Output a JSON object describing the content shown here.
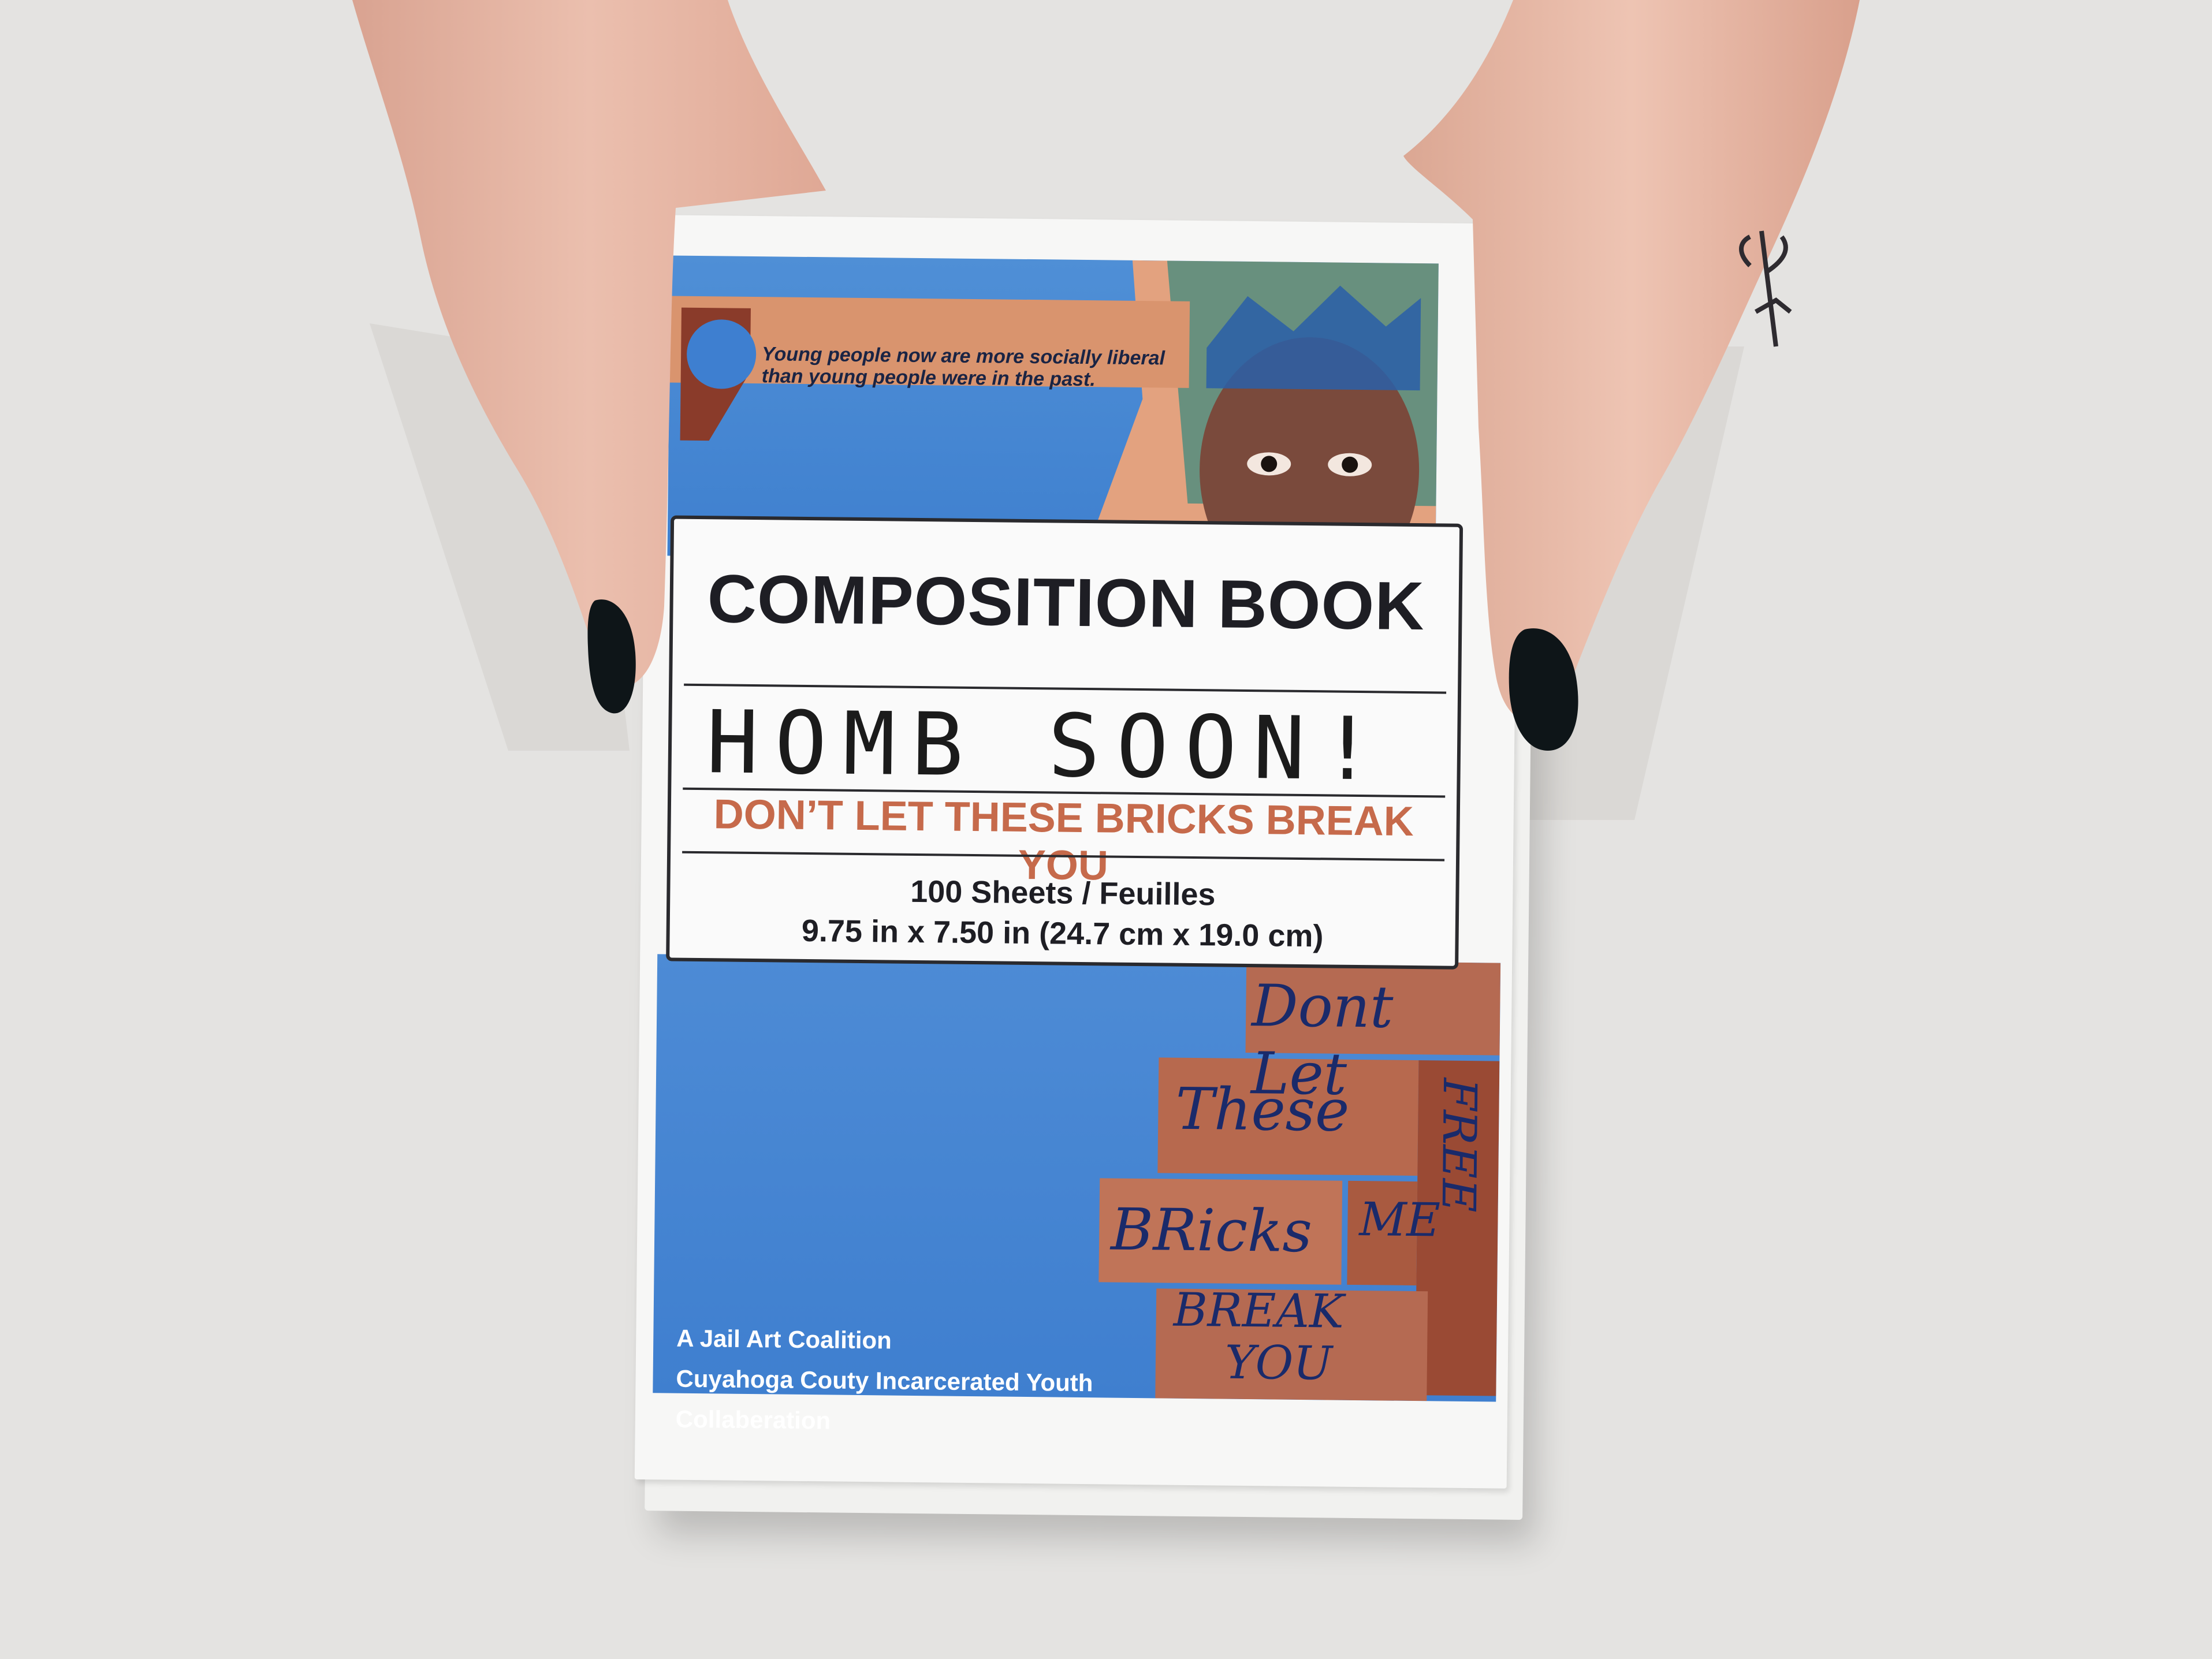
{
  "cover": {
    "title": "COMPOSITION BOOK",
    "handwritten_name": "HOMB SOON!",
    "tagline": "DON’T LET THESE BRICKS BREAK YOU",
    "sheets": "100 Sheets / Feuilles",
    "dimensions": "9.75 in x 7.50 in (24.7 cm x 19.0 cm)",
    "quote_line1": "Young people now are more socially liberal",
    "quote_line2": "than young people were in the past.",
    "credits": [
      "A Jail Art Coalition",
      "Cuyahoga Couty Incarcerated Youth",
      "Collaberation"
    ],
    "brick_words": [
      "Dont Let",
      "These",
      "BRicks",
      "BREAK",
      "YOU",
      "FREE",
      "ME"
    ]
  },
  "colors": {
    "background": "#e4e3e1",
    "cover_blue": "#4585d2",
    "brick": "#b7694e",
    "skin": "#e8b8a6",
    "nail": "#0e1518"
  },
  "icon_names": [
    "hand-left",
    "hand-right",
    "tattoo-icon"
  ]
}
